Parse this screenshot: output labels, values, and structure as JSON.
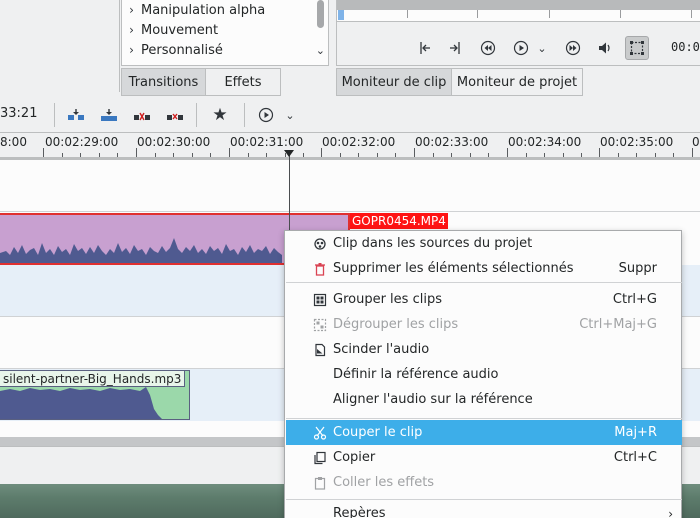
{
  "effects_tree": {
    "items": [
      {
        "label": "Manipulation alpha"
      },
      {
        "label": "Mouvement"
      },
      {
        "label": "Personnalisé"
      }
    ],
    "tabs": [
      {
        "label": "Transitions",
        "active": true
      },
      {
        "label": "Effets",
        "active": false
      }
    ]
  },
  "monitor": {
    "timecode": "00:0",
    "tabs": [
      {
        "label": "Moniteur de clip",
        "active": true
      },
      {
        "label": "Moniteur de projet",
        "active": false
      }
    ]
  },
  "timeline": {
    "timecode": "33:21",
    "ruler": [
      "8:00",
      "00:02:29:00",
      "00:02:30:00",
      "00:02:31:00",
      "00:02:32:00",
      "00:02:33:00",
      "00:02:34:00",
      "00:02:35:00",
      "0"
    ],
    "clips": {
      "video": "GOPR0454.MP4",
      "audio": "silent-partner-Big_Hands.mp3"
    }
  },
  "context_menu": {
    "items": [
      {
        "label": "Clip dans les sources du projet",
        "shortcut": "",
        "icon": "clip-source-icon",
        "enabled": true
      },
      {
        "label": "Supprimer les éléments sélectionnés",
        "shortcut": "Suppr",
        "icon": "trash-icon",
        "enabled": true
      },
      {
        "label": "Grouper les clips",
        "shortcut": "Ctrl+G",
        "icon": "group-icon",
        "enabled": true
      },
      {
        "label": "Dégrouper les clips",
        "shortcut": "Ctrl+Maj+G",
        "icon": "ungroup-icon",
        "enabled": false
      },
      {
        "label": "Scinder l'audio",
        "shortcut": "",
        "icon": "split-audio-icon",
        "enabled": true
      },
      {
        "label": "Définir la référence audio",
        "shortcut": "",
        "icon": "",
        "enabled": true
      },
      {
        "label": "Aligner l'audio sur la référence",
        "shortcut": "",
        "icon": "",
        "enabled": true
      },
      {
        "label": "Couper le clip",
        "shortcut": "Maj+R",
        "icon": "scissors-icon",
        "enabled": true,
        "highlighted": true
      },
      {
        "label": "Copier",
        "shortcut": "Ctrl+C",
        "icon": "copy-icon",
        "enabled": true
      },
      {
        "label": "Coller les effets",
        "shortcut": "",
        "icon": "paste-icon",
        "enabled": false
      },
      {
        "label": "Repères",
        "shortcut": "",
        "icon": "",
        "enabled": true,
        "submenu": true
      }
    ]
  },
  "colors": {
    "accent": "#3daee9",
    "video_clip": "#c8a0d0",
    "audio_clip": "#9bd8aa",
    "selection_border": "#e03030",
    "clip_label_bg": "#ff1414"
  }
}
